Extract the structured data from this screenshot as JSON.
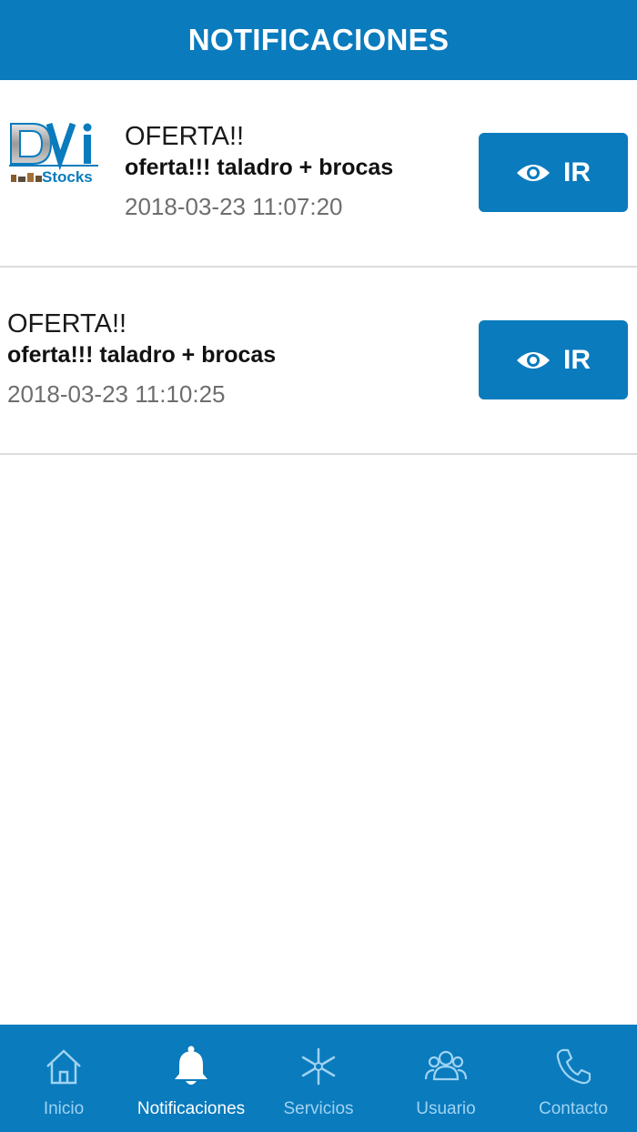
{
  "header": {
    "title": "NOTIFICACIONES"
  },
  "notifications": [
    {
      "has_logo": true,
      "logo_text": "DVi Stocks",
      "title": "OFERTA!!",
      "subtitle": "oferta!!! taladro + brocas",
      "date": "2018-03-23 11:07:20",
      "button_label": "IR",
      "button_icon": "eye-icon"
    },
    {
      "has_logo": false,
      "title": "OFERTA!!",
      "subtitle": "oferta!!! taladro + brocas",
      "date": "2018-03-23 11:10:25",
      "button_label": "IR",
      "button_icon": "eye-icon"
    }
  ],
  "tabbar": {
    "items": [
      {
        "label": "Inicio",
        "icon": "home-icon",
        "active": false
      },
      {
        "label": "Notificaciones",
        "icon": "bell-icon",
        "active": true
      },
      {
        "label": "Servicios",
        "icon": "asterisk-icon",
        "active": false
      },
      {
        "label": "Usuario",
        "icon": "users-icon",
        "active": false
      },
      {
        "label": "Contacto",
        "icon": "phone-icon",
        "active": false
      }
    ]
  },
  "colors": {
    "primary": "#0a7bbd",
    "tab_inactive": "#9fd3f2",
    "tab_active": "#ffffff",
    "date_text": "#6e6e6e",
    "divider": "#dcdcdc"
  }
}
